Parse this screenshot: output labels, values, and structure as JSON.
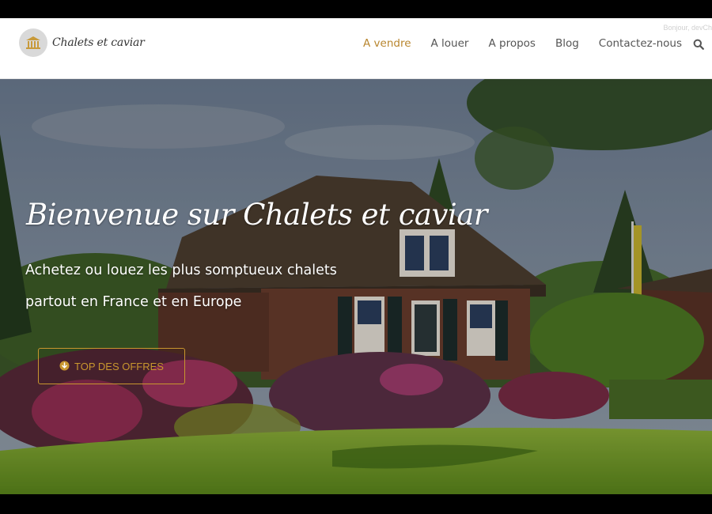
{
  "site": {
    "logo_text": "Chalets et caviar",
    "greeting": "Bonjour, devCh"
  },
  "nav": {
    "items": [
      {
        "label": "A vendre",
        "active": true
      },
      {
        "label": "A louer",
        "active": false
      },
      {
        "label": "A propos",
        "active": false
      },
      {
        "label": "Blog",
        "active": false
      },
      {
        "label": "Contactez-nous",
        "active": false
      }
    ],
    "search_icon": "search-icon"
  },
  "hero": {
    "title": "Bienvenue sur Chalets et caviar",
    "subtitle_line1": "Achetez ou louez les plus somptueux chalets",
    "subtitle_line2": "partout en France et en Europe",
    "cta_label": "TOP DES OFFRES",
    "cta_icon": "arrow-circle-down-icon"
  },
  "colors": {
    "accent": "#b8862f",
    "nav_text": "#555555",
    "hero_text": "#ffffff"
  }
}
